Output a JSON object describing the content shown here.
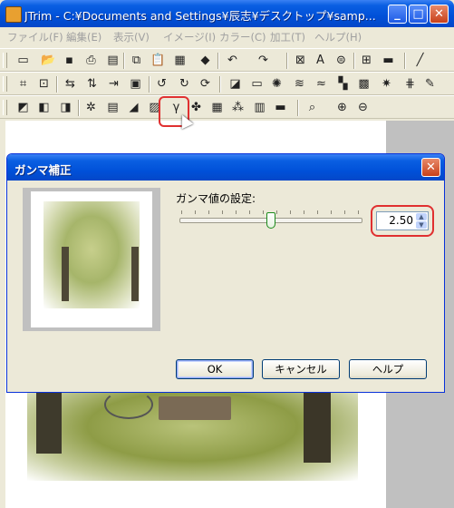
{
  "window": {
    "title": "JTrim - C:¥Documents and Settings¥辰志¥デスクトップ¥samp...",
    "min_label": "_",
    "max_label": "□",
    "close_label": "✕"
  },
  "menu": [
    {
      "label": "ファイル(F)"
    },
    {
      "label": "編集(E)"
    },
    {
      "label": "表示(V)"
    },
    {
      "label": "イメージ(I)"
    },
    {
      "label": "カラー(C)"
    },
    {
      "label": "加工(T)"
    },
    {
      "label": "ヘルプ(H)"
    }
  ],
  "dialog": {
    "title": "ガンマ補正",
    "gamma_label": "ガンマ値の設定:",
    "gamma_value": "2.50",
    "gamma_level_fraction": 0.5,
    "ok_label": "OK",
    "cancel_label": "キャンセル",
    "help_label": "ヘルプ",
    "close_label": "✕"
  },
  "toolbar_icons": {
    "row1": [
      "new-icon",
      "open-icon",
      "save-icon",
      "print-icon",
      "copy-icon",
      "paste-icon",
      "paste-new-icon",
      "capture-icon",
      "undo-icon",
      "redo-icon",
      "fit-icon",
      "text-icon",
      "stamp-icon",
      "grid-icon",
      "filmstrip-icon",
      "eyedropper-icon"
    ],
    "row2": [
      "crop-icon",
      "trim-icon",
      "flip-horizontal-icon",
      "flip-vertical-icon",
      "resize-icon",
      "frame-icon",
      "rotate-left-icon",
      "rotate-90-icon",
      "rotate-right-icon",
      "shadow-icon",
      "border-icon",
      "spotlight-icon",
      "wave-icon",
      "mosaic-icon",
      "contrast-icon",
      "sharpen-icon",
      "pencil-icon"
    ],
    "row3": [
      "grayscale-icon",
      "sepia-icon",
      "negative-icon",
      "brightness-icon",
      "color-balance-icon",
      "saturation-icon",
      "levels-icon",
      "gamma-icon",
      "hue-icon",
      "checker-icon",
      "rgb-icon",
      "xor-icon",
      "stripe-icon",
      "zoom-icon",
      "zoom-in-icon",
      "zoom-out-icon"
    ]
  },
  "colors": {
    "xp_blue": "#0050d8",
    "highlight_red": "#e03030",
    "window_face": "#ece9d8"
  }
}
